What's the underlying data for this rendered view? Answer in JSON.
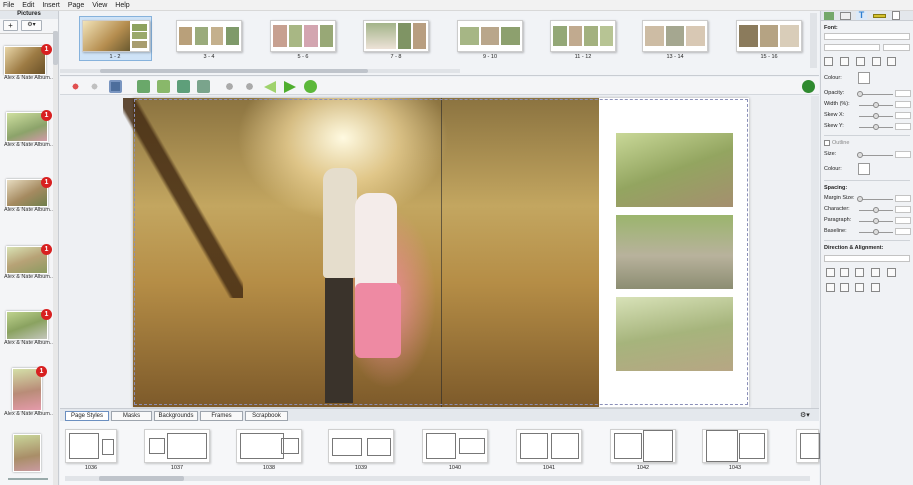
{
  "menu": [
    "File",
    "Edit",
    "Insert",
    "Page",
    "View",
    "Help"
  ],
  "pictures": {
    "title": "Pictures",
    "add_label": "+",
    "settings_label": "⚙▾",
    "items": [
      {
        "caption": "Alex & Nate Album...",
        "badge": "1"
      },
      {
        "caption": "Alex & Nate Album...",
        "badge": "1"
      },
      {
        "caption": "Alex & Nate Album...",
        "badge": "1"
      },
      {
        "caption": "Alex & Nate Album...",
        "badge": "1"
      },
      {
        "caption": "Alex & Nate Album...",
        "badge": "1"
      },
      {
        "caption": "Alex & Nate Album...",
        "badge": "1"
      }
    ]
  },
  "spreads": [
    "1 - 2",
    "3 - 4",
    "5 - 6",
    "7 - 8",
    "9 - 10",
    "11 - 12",
    "13 - 14",
    "15 - 16"
  ],
  "bottom_tabs": [
    "Page Styles",
    "Masks",
    "Backgrounds",
    "Frames",
    "Scrapbook"
  ],
  "templates": [
    "1036",
    "1037",
    "1038",
    "1039",
    "1040",
    "1041",
    "1042",
    "1043"
  ],
  "right": {
    "font_label": "Font:",
    "colour_label": "Colour:",
    "opacity_label": "Opacity:",
    "width_label": "Width (%):",
    "skewx_label": "Skew X:",
    "skewy_label": "Skew Y:",
    "outline_label": "Outline",
    "size_label": "Size:",
    "colour2_label": "Colour:",
    "spacing_label": "Spacing:",
    "margin_label": "Margin Size:",
    "character_label": "Character:",
    "paragraph_label": "Paragraph:",
    "baseline_label": "Baseline:",
    "direction_label": "Direction & Alignment:"
  },
  "colors": {
    "accent": "#2e7fd0",
    "badge": "#d82020",
    "panel": "#f0f2f5"
  }
}
